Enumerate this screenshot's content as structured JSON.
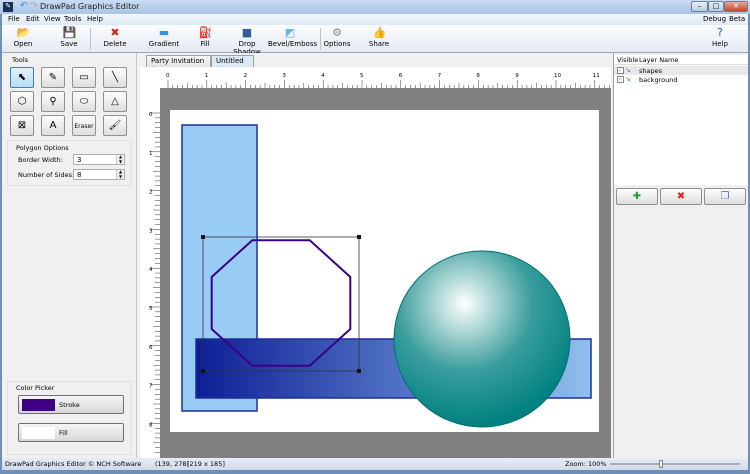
{
  "window": {
    "title": "DrawPad Graphics Editor",
    "min": "–",
    "max": "□",
    "close": "✕"
  },
  "menu": [
    "File",
    "Edit",
    "View",
    "Tools",
    "Help"
  ],
  "menu_right": [
    "Debug",
    "Beta"
  ],
  "toolbar": [
    {
      "label": "Open",
      "icon": "folder-icon",
      "glyph": "📂",
      "color": "#d9a21b"
    },
    {
      "label": "Save",
      "icon": "floppy-icon",
      "glyph": "💾",
      "color": "#4a6fa5"
    },
    {
      "label": "Delete",
      "icon": "red-x-icon",
      "glyph": "✖",
      "color": "#d52a1f"
    },
    {
      "label": "Gradient",
      "icon": "gradient-icon",
      "glyph": "▬",
      "color": "#3a8fd6"
    },
    {
      "label": "Fill",
      "icon": "paint-bucket-icon",
      "glyph": "⛽",
      "color": "#c2185b"
    },
    {
      "label": "Drop Shadow",
      "icon": "drop-shadow-icon",
      "glyph": "■",
      "color": "#2d5e9e"
    },
    {
      "label": "Bevel/Emboss",
      "icon": "bevel-icon",
      "glyph": "◩",
      "color": "#6ab4ea"
    },
    {
      "label": "Options",
      "icon": "options-icon",
      "glyph": "⚙",
      "color": "#888"
    },
    {
      "label": "Share",
      "icon": "share-icon",
      "glyph": "👍",
      "color": "#3a7bd5"
    },
    {
      "label": "Help",
      "icon": "help-icon",
      "glyph": "?",
      "color": "#1f5fb8"
    }
  ],
  "tools_label": "Tools",
  "tools": [
    {
      "name": "select",
      "glyph": "⬉"
    },
    {
      "name": "pencil",
      "glyph": "✎"
    },
    {
      "name": "rectangle",
      "glyph": "▭"
    },
    {
      "name": "line",
      "glyph": "╲"
    },
    {
      "name": "polygon",
      "glyph": "⬡"
    },
    {
      "name": "eyedropper",
      "glyph": "⚲"
    },
    {
      "name": "ellipse",
      "glyph": "⬭"
    },
    {
      "name": "triangle",
      "glyph": "△"
    },
    {
      "name": "crop",
      "glyph": "⊠"
    },
    {
      "name": "text",
      "glyph": "A"
    },
    {
      "name": "eraser",
      "glyph": "Eraser"
    },
    {
      "name": "brush",
      "glyph": "🖌"
    }
  ],
  "polygon_options": {
    "title": "Polygon Options",
    "border_width_label": "Border Width:",
    "border_width": "3",
    "sides_label": "Number of Sides:",
    "sides": "8"
  },
  "color_picker": {
    "title": "Color Picker",
    "stroke_label": "Stroke",
    "stroke_color": "#3d0085",
    "fill_label": "Fill",
    "fill_color": "#ffffff"
  },
  "tabs": [
    {
      "label": "Party Invitation",
      "close": "✕"
    },
    {
      "label": "Untitled",
      "close": "✕",
      "active": true
    }
  ],
  "ruler": {
    "h": [
      "0",
      "1",
      "2",
      "3",
      "4",
      "5",
      "6",
      "7",
      "8",
      "9",
      "10",
      "11"
    ],
    "v": [
      "0",
      "1",
      "2",
      "3",
      "4",
      "5",
      "6",
      "7",
      "8"
    ]
  },
  "layers": {
    "headers": [
      "Visible",
      "Layer Name"
    ],
    "rows": [
      {
        "name": "shapes",
        "visible": true
      },
      {
        "name": "background",
        "visible": true
      }
    ],
    "buttons": [
      {
        "icon": "add-layer-icon",
        "glyph": "✚",
        "color": "#2a9a2a"
      },
      {
        "icon": "delete-layer-icon",
        "glyph": "✖",
        "color": "#d52a1f"
      },
      {
        "icon": "duplicate-layer-icon",
        "glyph": "❐",
        "color": "#3a7bd5"
      }
    ]
  },
  "status": {
    "app": "DrawPad Graphics Editor © NCH Software",
    "coords": "(139, 278)",
    "size": "[219 x 185]",
    "zoom_label": "Zoom: 100%",
    "zoom": 100
  },
  "colors": {
    "light_rect": "#99ccf5",
    "rect_border": "#1a2f9c",
    "gradient_start": "#0e1f96",
    "gradient_end": "#8fbfee",
    "sphere": "#008080",
    "octagon": "#3d0085"
  }
}
